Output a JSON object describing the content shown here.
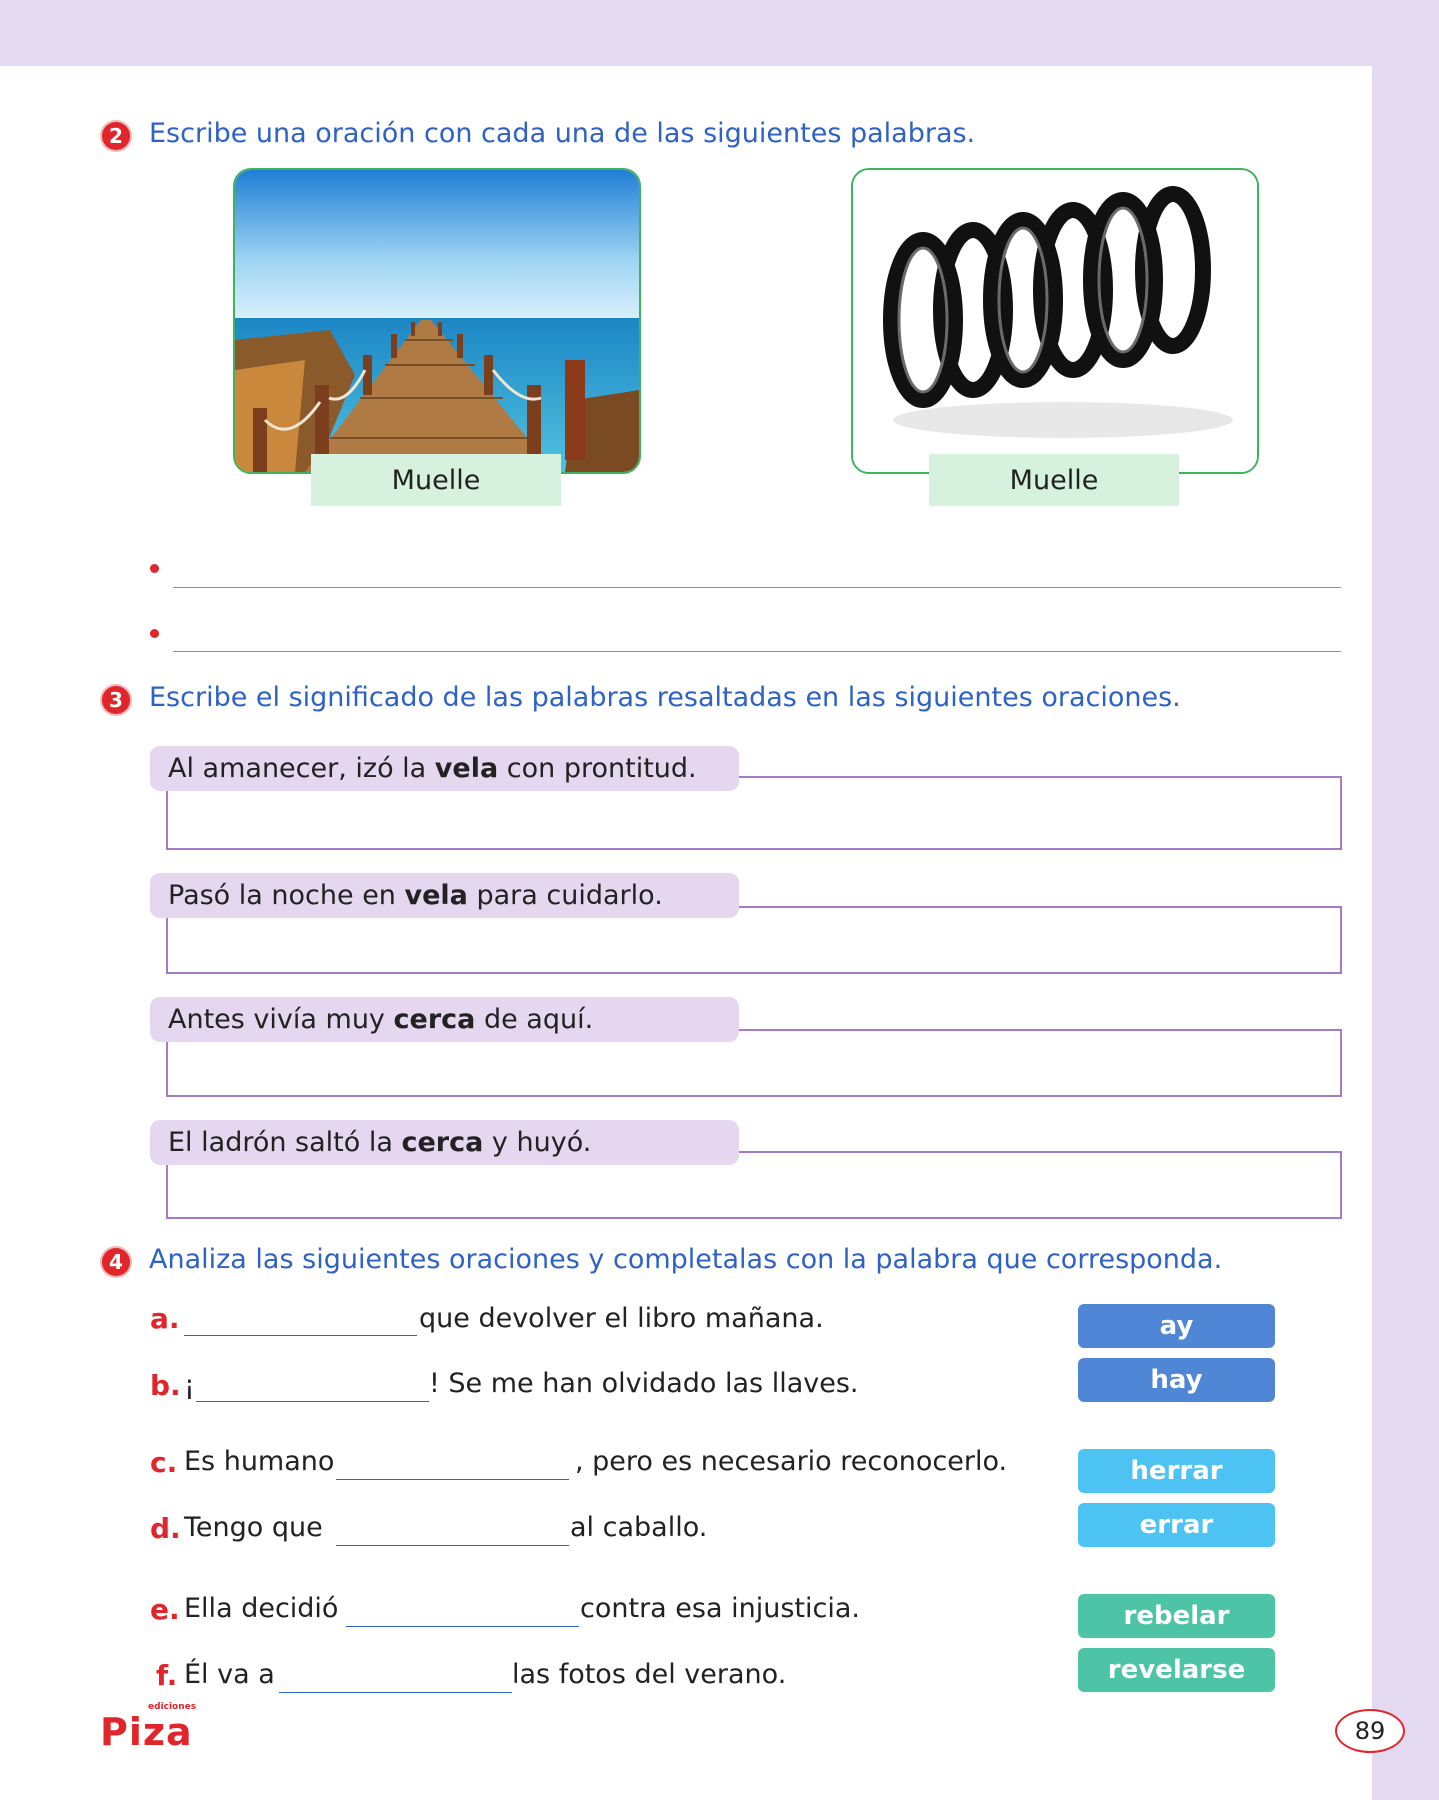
{
  "exercise2": {
    "number": "2",
    "title": "Escribe una oración con cada una de las siguientes palabras.",
    "images": [
      {
        "label": "Muelle",
        "depicts": "pier over sea"
      },
      {
        "label": "Muelle",
        "depicts": "metal coil spring"
      }
    ]
  },
  "exercise3": {
    "number": "3",
    "title": "Escribe el significado de las palabras resaltadas en las siguientes oraciones.",
    "sentences": [
      {
        "before": "Al amanecer, izó la ",
        "bold": "vela",
        "after": " con prontitud."
      },
      {
        "before": "Pasó la noche en ",
        "bold": "vela",
        "after": " para cuidarlo."
      },
      {
        "before": "Antes vivía muy ",
        "bold": "cerca",
        "after": " de aquí."
      },
      {
        "before": "El ladrón saltó la ",
        "bold": "cerca",
        "after": " y huyó."
      }
    ]
  },
  "exercise4": {
    "number": "4",
    "title": "Analiza las siguientes oraciones y completalas con la palabra que corresponda.",
    "items": [
      {
        "letter": "a.",
        "before": "",
        "after": "que devolver el libro mañana."
      },
      {
        "letter": "b.",
        "before": "¡",
        "after": "! Se me han olvidado las llaves."
      },
      {
        "letter": "c.",
        "before": "Es humano",
        "after": ", pero es necesario reconocerlo."
      },
      {
        "letter": "d.",
        "before": "Tengo que",
        "after": "al caballo."
      },
      {
        "letter": "e.",
        "before": "Ella decidió",
        "after": "contra esa injusticia."
      },
      {
        "letter": "f.",
        "before": "Él va a",
        "after": "las fotos del verano."
      }
    ],
    "words": [
      "ay",
      "hay",
      "herrar",
      "errar",
      "rebelar",
      "revelarse"
    ]
  },
  "footer": {
    "logo": "Piza",
    "logo_sub": "ediciones",
    "page_number": "89"
  },
  "colors": {
    "accent_red": "#e0262b",
    "title_blue": "#2e62c4",
    "band_lilac": "#e3d9f0"
  }
}
